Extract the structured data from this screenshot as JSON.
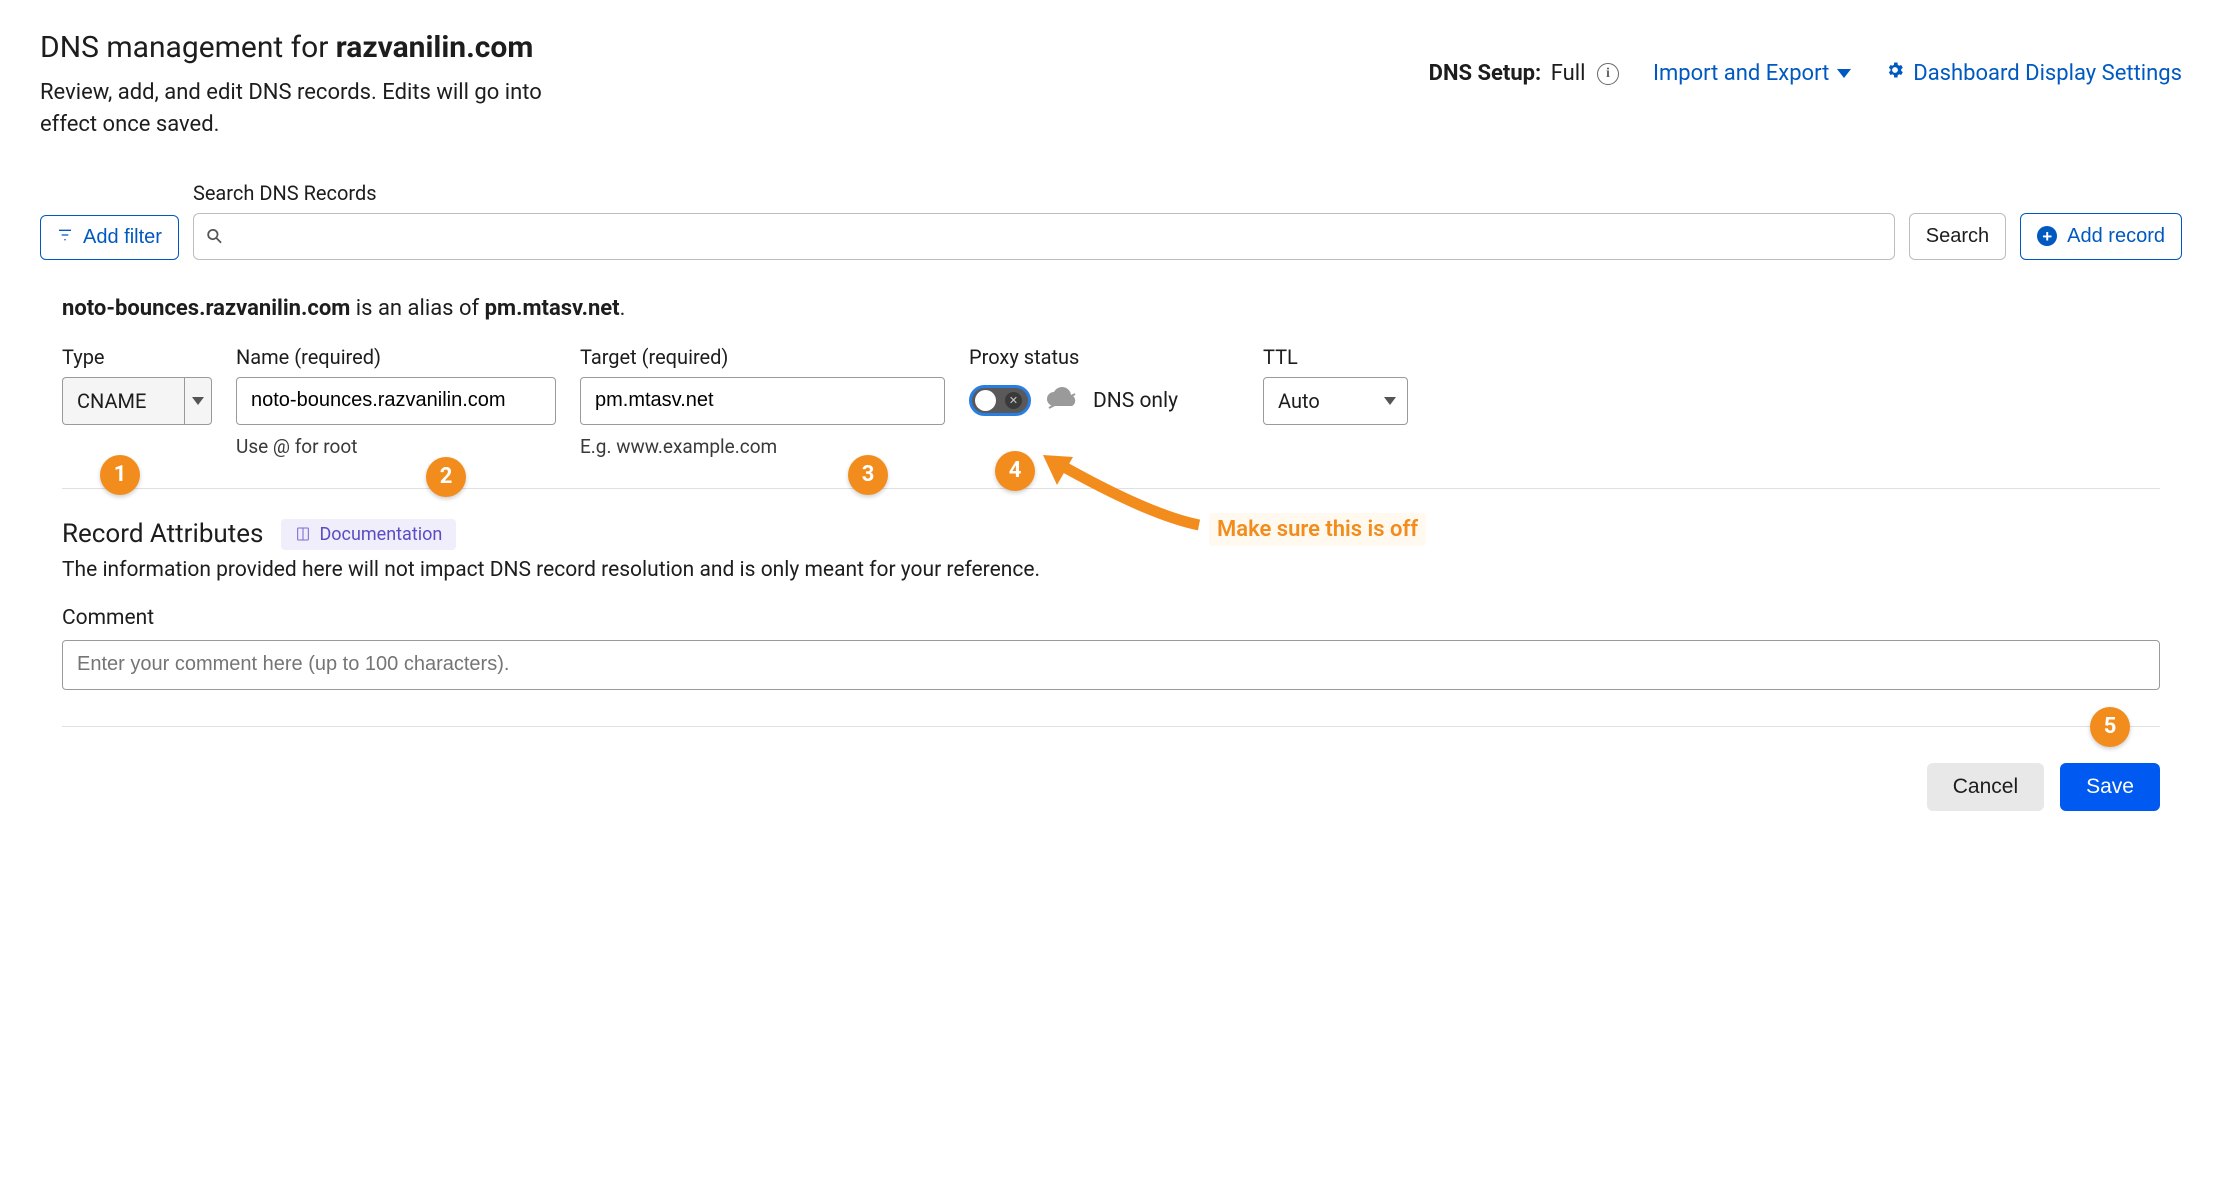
{
  "header": {
    "title_pre": "DNS management for ",
    "title_domain": "razvanilin.com",
    "subtitle": "Review, add, and edit DNS records. Edits will go into effect once saved."
  },
  "topbar": {
    "dns_setup_label": "DNS Setup:",
    "dns_setup_value": "Full",
    "import_export": "Import and Export",
    "dashboard_settings": "Dashboard Display Settings"
  },
  "search": {
    "add_filter": "Add filter",
    "label": "Search DNS Records",
    "placeholder": "",
    "search_btn": "Search",
    "add_record": "Add record"
  },
  "alias": {
    "host": "noto-bounces.razvanilin.com",
    "mid": " is an alias of ",
    "target": "pm.mtasv.net",
    "end": "."
  },
  "form": {
    "type_label": "Type",
    "type_value": "CNAME",
    "name_label": "Name (required)",
    "name_value": "noto-bounces.razvanilin.com",
    "name_hint": "Use @ for root",
    "target_label": "Target (required)",
    "target_value": "pm.mtasv.net",
    "target_hint": "E.g. www.example.com",
    "proxy_label": "Proxy status",
    "proxy_text": "DNS only",
    "ttl_label": "TTL",
    "ttl_value": "Auto"
  },
  "attrs": {
    "heading": "Record Attributes",
    "doc_link": "Documentation",
    "desc": "The information provided here will not impact DNS record resolution and is only meant for your reference.",
    "comment_label": "Comment",
    "comment_placeholder": "Enter your comment here (up to 100 characters)."
  },
  "actions": {
    "cancel": "Cancel",
    "save": "Save"
  },
  "annotations": {
    "c1": "1",
    "c2": "2",
    "c3": "3",
    "c4": "4",
    "c5": "5",
    "note": "Make sure this is off"
  }
}
